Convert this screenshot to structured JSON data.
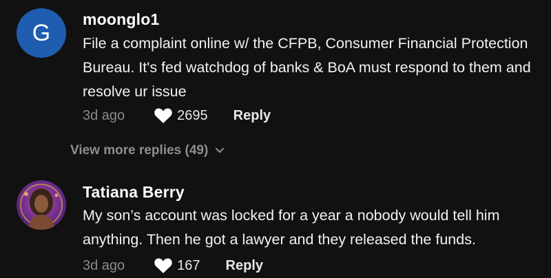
{
  "comments": [
    {
      "avatar_letter": "G",
      "avatar_color": "#1f5db0",
      "username": "moonglo1",
      "text": "File a complaint online w/ the CFPB, Consumer Financial Protection Bureau. It's fed watchdog of banks & BoA must respond to them and resolve ur issue",
      "time": "3d ago",
      "likes": "2695",
      "reply_label": "Reply"
    },
    {
      "avatar_letter": "",
      "avatar_color": "#6a2b8c",
      "username": "Tatiana Berry",
      "text": "My son’s account was locked for a year a nobody would tell him anything. Then he got a lawyer and they released the funds.",
      "time": "3d ago",
      "likes": "167",
      "reply_label": "Reply"
    }
  ],
  "view_more": {
    "label": "View more replies (49)"
  },
  "icons": {
    "heart": "heart-icon",
    "chevron": "chevron-down-icon"
  },
  "colors": {
    "background": "#111111",
    "muted_text": "#8a8a8a"
  }
}
